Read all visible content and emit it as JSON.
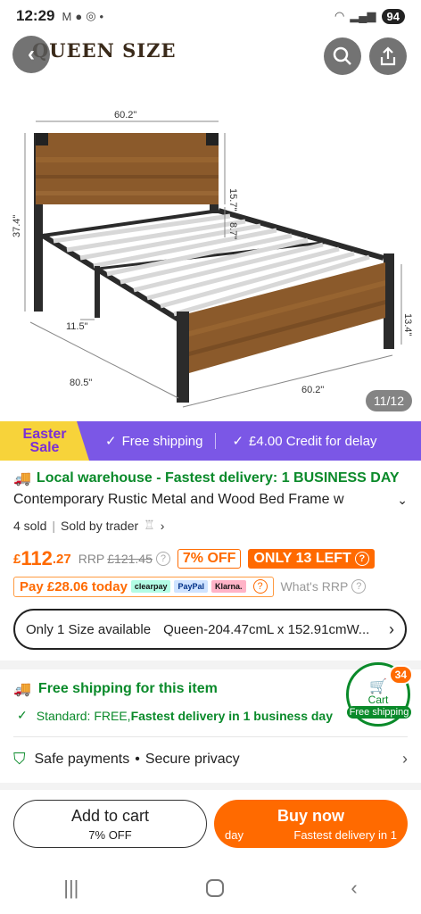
{
  "status": {
    "time": "12:29",
    "battery": "94"
  },
  "gallery": {
    "brand": "QUEEN SIZE",
    "counter": "11/12",
    "dims": {
      "top_width": "60.2\"",
      "head_height": "15.7\"",
      "gap": "8.7\"",
      "height": "37.4\"",
      "leg": "11.5\"",
      "length": "80.5\"",
      "foot_width": "60.2\"",
      "foot_height": "13.4\""
    }
  },
  "promo": {
    "easter1": "Easter",
    "easter2": "Sale",
    "free_shipping": "Free shipping",
    "credit": "£4.00 Credit for delay"
  },
  "product": {
    "delivery": "Local warehouse - Fastest delivery: 1 BUSINESS DAY",
    "title": "Contemporary Rustic Metal and Wood Bed Frame w",
    "sold": "4 sold",
    "sold_by": "Sold by trader",
    "currency": "£",
    "price_int": "112",
    "price_dec": ".27",
    "rrp_label": "RRP",
    "rrp": "£121.45",
    "discount": "7% OFF",
    "stock": "ONLY 13 LEFT",
    "pay_today": "Pay £28.06 today",
    "pay_tags": [
      "clearpay",
      "PayPal",
      "Klarna."
    ],
    "whats_rrp": "What's RRP"
  },
  "size": {
    "label": "Only 1 Size available",
    "value": "Queen-204.47cmL x 152.91cmW..."
  },
  "shipping": {
    "title": "Free shipping for this item",
    "standard_prefix": "Standard: FREE, ",
    "standard_bold": "Fastest delivery in 1 business day"
  },
  "cart": {
    "count": "34",
    "label": "Cart",
    "free": "Free shipping"
  },
  "safe": {
    "text1": "Safe payments",
    "dot": "•",
    "text2": "Secure privacy"
  },
  "buttons": {
    "add": "Add to cart",
    "add_sub": "7% OFF",
    "buy": "Buy now",
    "buy_sub_left": "day",
    "buy_sub_right": "Fastest delivery in 1"
  },
  "colors": {
    "accent": "#ff6a00",
    "green": "#0a8a2a",
    "promo": "#7b57e6"
  }
}
